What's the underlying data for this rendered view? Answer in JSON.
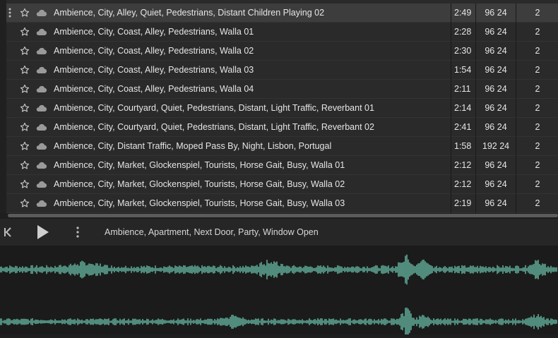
{
  "rows": [
    {
      "name": "Ambience, City, Alley, Quiet, Pedestrians, Distant Children Playing 02",
      "duration": "2:49",
      "format": "96 24",
      "channels": "2"
    },
    {
      "name": "Ambience, City, Coast, Alley, Pedestrians, Walla 01",
      "duration": "2:28",
      "format": "96 24",
      "channels": "2"
    },
    {
      "name": "Ambience, City, Coast, Alley, Pedestrians, Walla 02",
      "duration": "2:30",
      "format": "96 24",
      "channels": "2"
    },
    {
      "name": "Ambience, City, Coast, Alley, Pedestrians, Walla 03",
      "duration": "1:54",
      "format": "96 24",
      "channels": "2"
    },
    {
      "name": "Ambience, City, Coast, Alley, Pedestrians, Walla 04",
      "duration": "2:11",
      "format": "96 24",
      "channels": "2"
    },
    {
      "name": "Ambience, City, Courtyard, Quiet, Pedestrians, Distant, Light Traffic, Reverbant 01",
      "duration": "2:14",
      "format": "96 24",
      "channels": "2"
    },
    {
      "name": "Ambience, City, Courtyard, Quiet, Pedestrians, Distant, Light Traffic, Reverbant 02",
      "duration": "2:41",
      "format": "96 24",
      "channels": "2"
    },
    {
      "name": "Ambience, City, Distant Traffic, Moped Pass By, Night, Lisbon, Portugal",
      "duration": "1:58",
      "format": "192 24",
      "channels": "2"
    },
    {
      "name": "Ambience, City, Market, Glockenspiel, Tourists, Horse Gait, Busy, Walla 01",
      "duration": "2:12",
      "format": "96 24",
      "channels": "2"
    },
    {
      "name": "Ambience, City, Market, Glockenspiel, Tourists, Horse Gait, Busy, Walla 02",
      "duration": "2:12",
      "format": "96 24",
      "channels": "2"
    },
    {
      "name": "Ambience, City, Market, Glockenspiel, Tourists, Horse Gait, Busy, Walla 03",
      "duration": "2:19",
      "format": "96 24",
      "channels": "2"
    }
  ],
  "selected_row": 0,
  "player": {
    "track_title": "Ambience, Apartment, Next Door, Party, Window Open",
    "icons": {
      "rewind": "skip-back-icon",
      "play": "play-icon",
      "menu": "more-vertical-icon"
    }
  },
  "colors": {
    "waveform": "#5fa896",
    "selected_row": "#3d3d3d",
    "background": "#2a2a2a"
  },
  "row_icons": {
    "menu": "more-vertical-icon",
    "favorite": "star-outline-icon",
    "cloud": "cloud-icon"
  }
}
